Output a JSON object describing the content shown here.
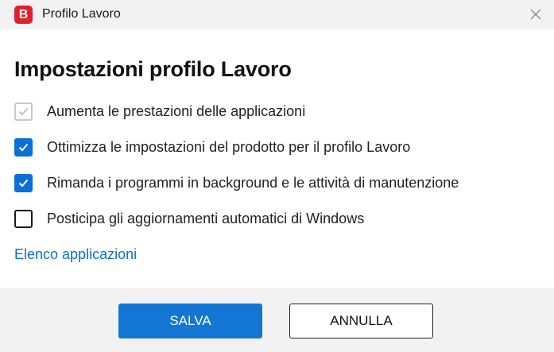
{
  "window": {
    "logo_letter": "B",
    "title": "Profilo Lavoro"
  },
  "main": {
    "heading": "Impostazioni profilo Lavoro",
    "options": [
      {
        "label": "Aumenta le prestazioni delle applicazioni",
        "checked": true,
        "disabled": true
      },
      {
        "label": "Ottimizza le impostazioni del prodotto per il profilo Lavoro",
        "checked": true,
        "disabled": false
      },
      {
        "label": "Rimanda i programmi in background e le attività di manutenzione",
        "checked": true,
        "disabled": false
      },
      {
        "label": "Posticipa gli aggiornamenti automatici di Windows",
        "checked": false,
        "disabled": false
      }
    ],
    "link": "Elenco applicazioni"
  },
  "footer": {
    "save_label": "SALVA",
    "cancel_label": "ANNULLA"
  },
  "colors": {
    "accent": "#0a6fd6",
    "brand": "#e0202a"
  }
}
